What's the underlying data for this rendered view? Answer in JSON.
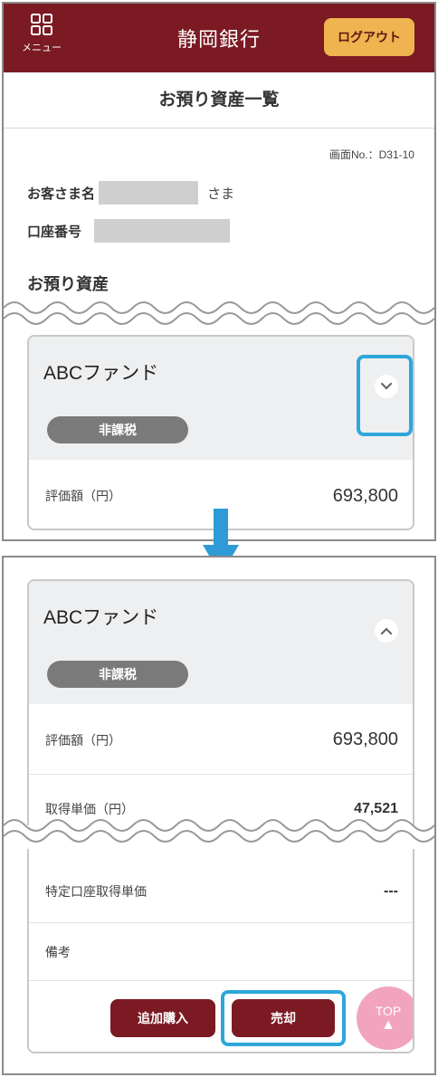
{
  "header": {
    "menu_label": "メニュー",
    "title": "静岡銀行",
    "logout_label": "ログアウト"
  },
  "page": {
    "title": "お預り資産一覧",
    "screen_no": "画面No.：D31-10"
  },
  "customer": {
    "name_label": "お客さま名",
    "name_suffix": "さま",
    "account_label": "口座番号"
  },
  "section": {
    "title": "お預り資産"
  },
  "fund_collapsed": {
    "name": "ABCファンド",
    "tax_type": "非課税",
    "eval_label": "評価額（円）",
    "eval_value": "693,800"
  },
  "fund_expanded": {
    "name": "ABCファンド",
    "tax_type": "非課税",
    "eval_label": "評価額（円）",
    "eval_value": "693,800",
    "cost_label": "取得単価（円）",
    "cost_value": "47,521",
    "special_label": "特定口座取得単価",
    "special_value": "---",
    "memo_label": "備考",
    "add_button": "追加購入",
    "sell_button": "売却"
  },
  "top_button": {
    "label": "TOP",
    "arrow": "▲"
  },
  "colors": {
    "brand": "#7b1a23",
    "logout": "#efb34f",
    "highlight": "#2ea6da",
    "top_button": "#f2a4bf"
  },
  "icons": [
    "menu-grid-icon",
    "chevron-down-icon",
    "chevron-up-icon",
    "arrow-down-icon"
  ]
}
